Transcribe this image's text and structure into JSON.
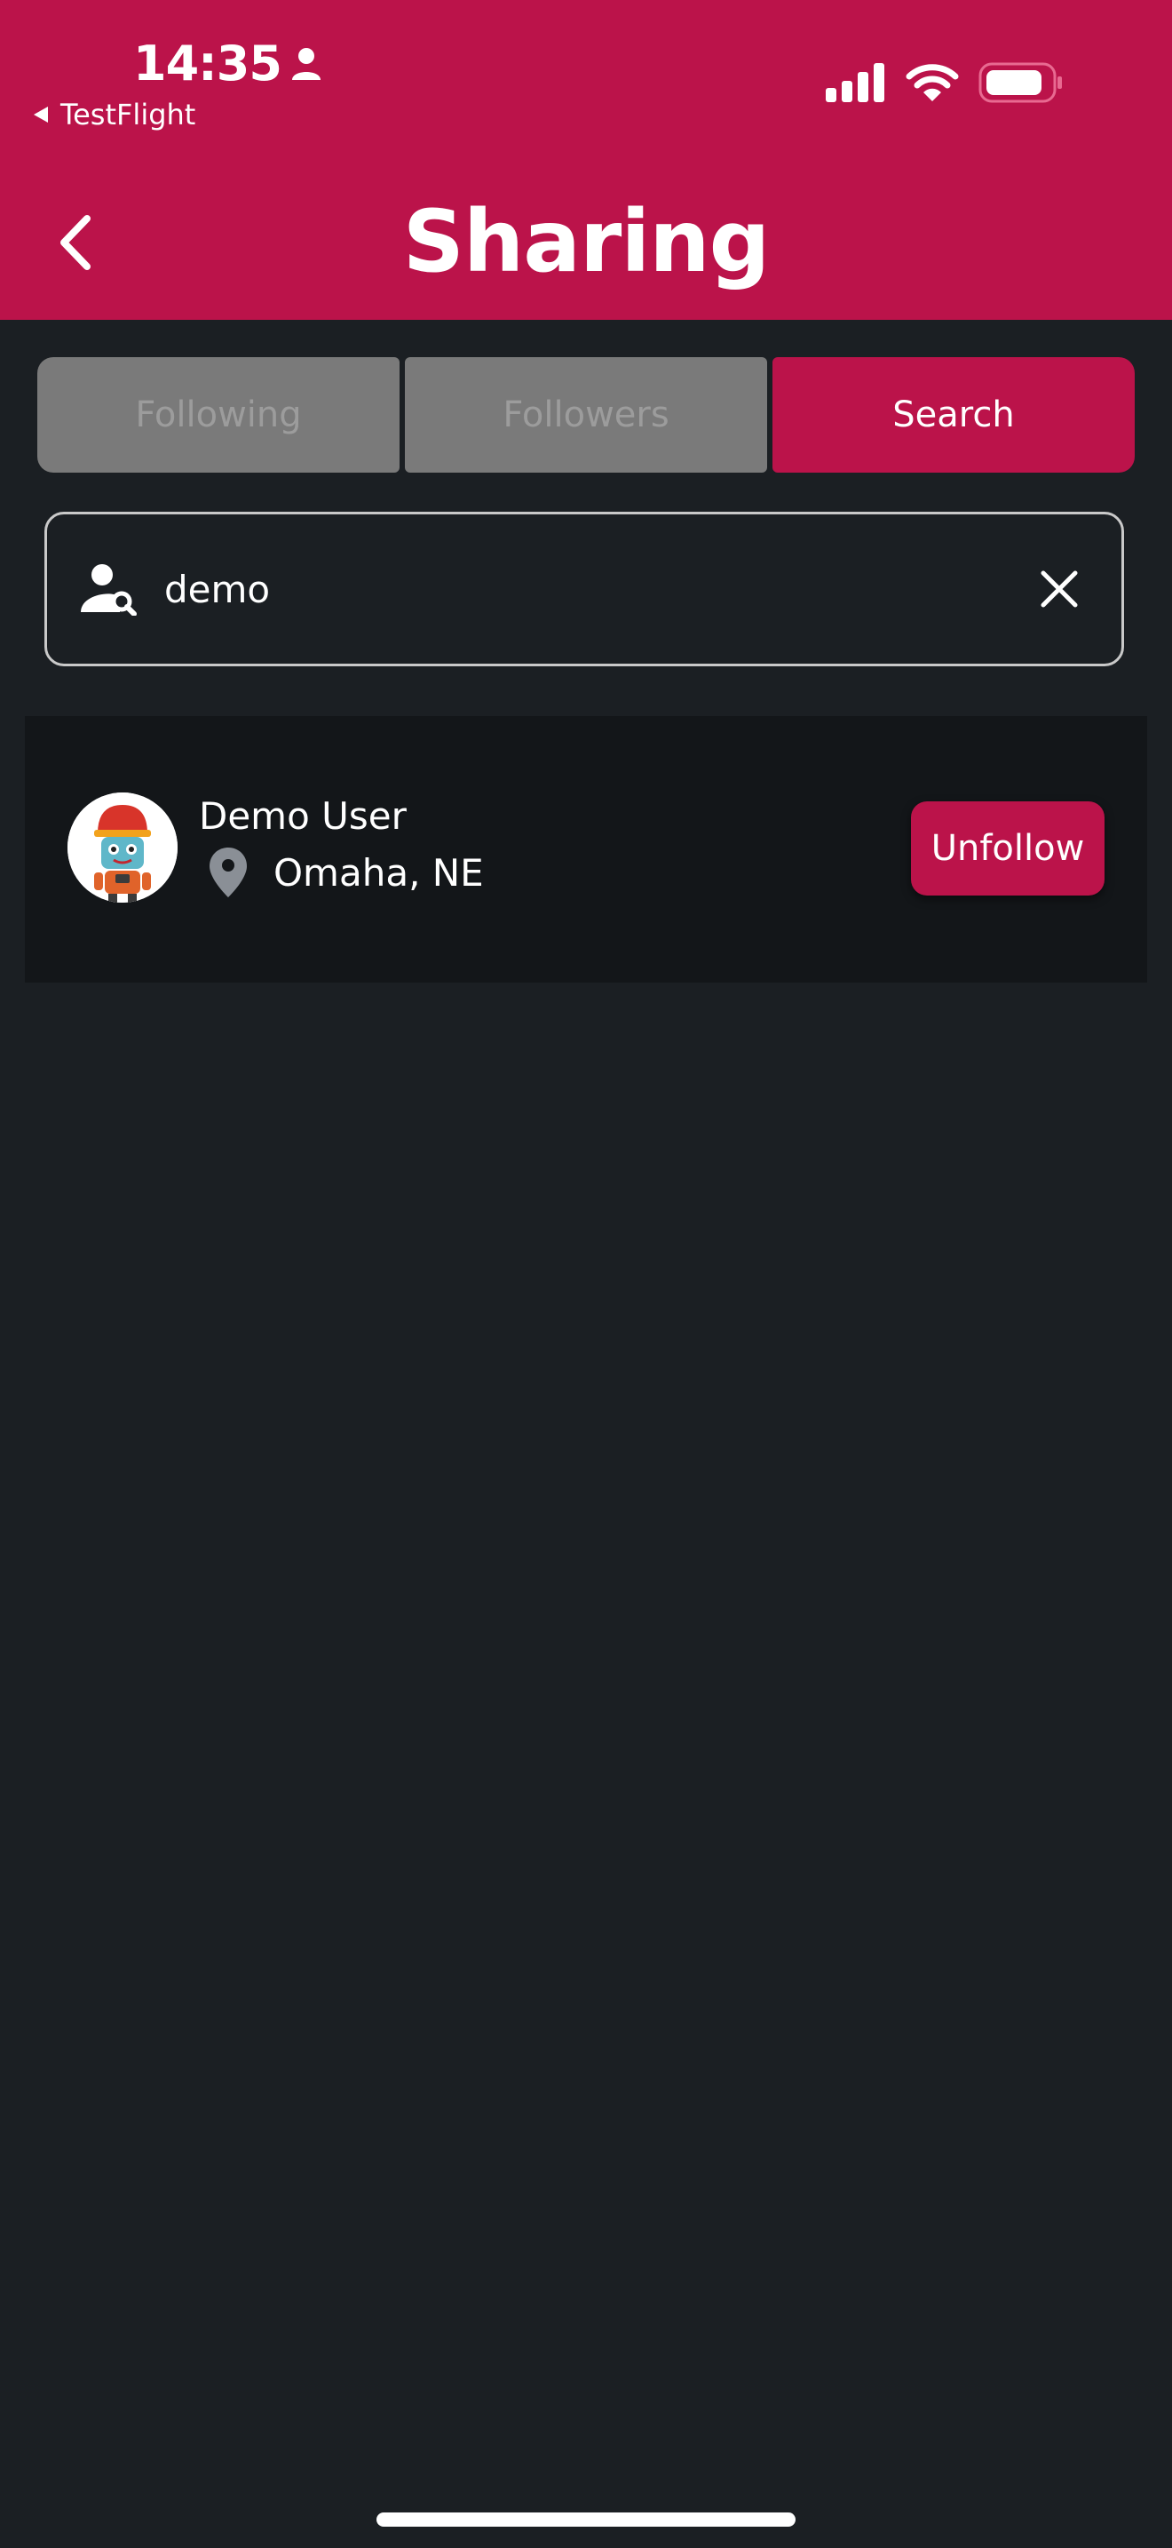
{
  "status_bar": {
    "time": "14:35",
    "back_app": "TestFlight"
  },
  "header": {
    "title": "Sharing"
  },
  "tabs": [
    {
      "label": "Following",
      "active": false
    },
    {
      "label": "Followers",
      "active": false
    },
    {
      "label": "Search",
      "active": true
    }
  ],
  "search": {
    "value": "demo"
  },
  "results": [
    {
      "name": "Demo User",
      "location": "Omaha, NE",
      "action_label": "Unfollow"
    }
  ],
  "colors": {
    "accent": "#bb134a",
    "background": "#1b1f23",
    "card": "#131619",
    "tab_inactive": "#7a7a7a"
  }
}
